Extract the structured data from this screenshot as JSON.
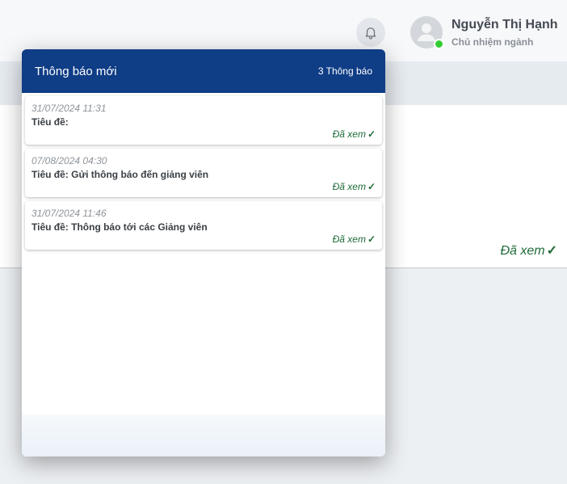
{
  "header": {
    "user_name": "Nguyễn Thị Hạnh",
    "user_role": "Chủ nhiệm ngành"
  },
  "background": {
    "read_status": "Đã xem",
    "check_icon": "✓"
  },
  "notifications": {
    "title": "Thông báo mới",
    "count_label": "3 Thông báo",
    "items": [
      {
        "time": "31/07/2024 11:31",
        "title": "Tiêu đề:",
        "status": "Đã xem"
      },
      {
        "time": "07/08/2024 04:30",
        "title": "Tiêu đề: Gửi thông báo đến giảng viên",
        "status": "Đã xem"
      },
      {
        "time": "31/07/2024 11:46",
        "title": "Tiêu đề: Thông báo tới các Giảng viên",
        "status": "Đã xem"
      }
    ]
  },
  "colors": {
    "header_blue": "#0f3d86",
    "read_green": "#1f6b3a",
    "online_green": "#33cc33"
  },
  "icons": [
    "bell-icon",
    "user-avatar-icon",
    "check-icon"
  ]
}
